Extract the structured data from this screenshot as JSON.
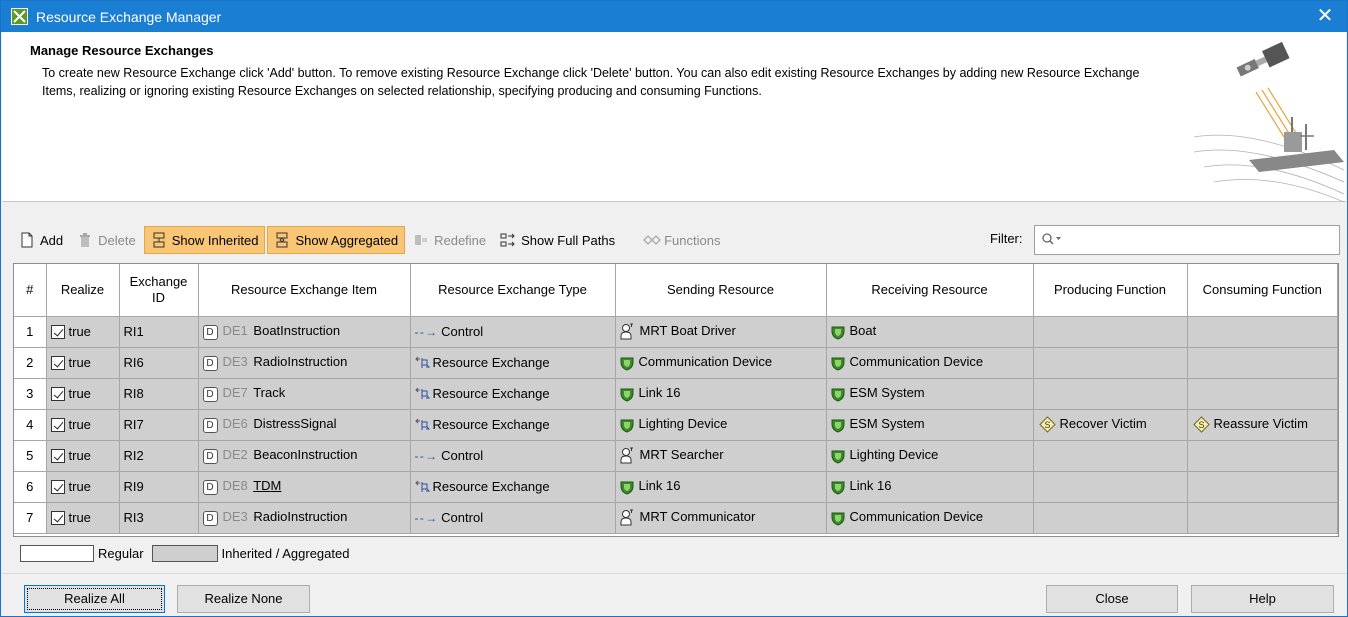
{
  "window": {
    "title": "Resource Exchange Manager",
    "close_glyph": "✕"
  },
  "header": {
    "title": "Manage Resource Exchanges",
    "description": "To create new Resource Exchange click 'Add' button. To remove existing Resource Exchange click 'Delete' button. You can also edit existing Resource Exchanges by adding new Resource Exchange Items, realizing or ignoring existing Resource Exchanges on selected relationship, specifying producing and consuming Functions."
  },
  "toolbar": {
    "add": "Add",
    "delete": "Delete",
    "show_inherited": "Show Inherited",
    "show_aggregated": "Show Aggregated",
    "redefine": "Redefine",
    "show_full_paths": "Show Full Paths",
    "functions": "Functions",
    "filter_label": "Filter:",
    "filter_value": ""
  },
  "table": {
    "columns": [
      "#",
      "Realize",
      "Exchange ID",
      "Resource Exchange Item",
      "Resource Exchange Type",
      "Sending Resource",
      "Receiving Resource",
      "Producing Function",
      "Consuming Function"
    ],
    "rows": [
      {
        "num": "1",
        "realize": "true",
        "id": "RI1",
        "item_id": "DE1",
        "item": "BoatInstruction",
        "item_underline": false,
        "type": "Control",
        "type_kind": "control",
        "sending": "MRT Boat Driver",
        "sending_kind": "person",
        "receiving": "Boat",
        "receiving_kind": "system",
        "producing": "",
        "consuming": ""
      },
      {
        "num": "2",
        "realize": "true",
        "id": "RI6",
        "item_id": "DE3",
        "item": "RadioInstruction",
        "item_underline": false,
        "type": "Resource Exchange",
        "type_kind": "exchange",
        "sending": "Communication Device",
        "sending_kind": "system",
        "receiving": "Communication Device",
        "receiving_kind": "system",
        "producing": "",
        "consuming": ""
      },
      {
        "num": "3",
        "realize": "true",
        "id": "RI8",
        "item_id": "DE7",
        "item": "Track",
        "item_underline": false,
        "type": "Resource Exchange",
        "type_kind": "exchange",
        "sending": "Link 16",
        "sending_kind": "system",
        "receiving": "ESM System",
        "receiving_kind": "system",
        "producing": "",
        "consuming": ""
      },
      {
        "num": "4",
        "realize": "true",
        "id": "RI7",
        "item_id": "DE6",
        "item": "DistressSignal",
        "item_underline": false,
        "type": "Resource Exchange",
        "type_kind": "exchange",
        "sending": "Lighting Device",
        "sending_kind": "system",
        "receiving": "ESM System",
        "receiving_kind": "system",
        "producing": "Recover Victim",
        "consuming": "Reassure Victim"
      },
      {
        "num": "5",
        "realize": "true",
        "id": "RI2",
        "item_id": "DE2",
        "item": "BeaconInstruction",
        "item_underline": false,
        "type": "Control",
        "type_kind": "control",
        "sending": "MRT Searcher",
        "sending_kind": "person",
        "receiving": "Lighting Device",
        "receiving_kind": "system",
        "producing": "",
        "consuming": ""
      },
      {
        "num": "6",
        "realize": "true",
        "id": "RI9",
        "item_id": "DE8",
        "item": "TDM",
        "item_underline": true,
        "type": "Resource Exchange",
        "type_kind": "exchange",
        "sending": "Link 16",
        "sending_kind": "system",
        "receiving": "Link 16",
        "receiving_kind": "system",
        "producing": "",
        "consuming": ""
      },
      {
        "num": "7",
        "realize": "true",
        "id": "RI3",
        "item_id": "DE3",
        "item": "RadioInstruction",
        "item_underline": false,
        "type": "Control",
        "type_kind": "control",
        "sending": "MRT Communicator",
        "sending_kind": "person",
        "receiving": "Communication Device",
        "receiving_kind": "system",
        "producing": "",
        "consuming": ""
      }
    ]
  },
  "legend": {
    "regular": "Regular",
    "inherited": "Inherited / Aggregated"
  },
  "footer": {
    "realize_all": "Realize All",
    "realize_none": "Realize None",
    "close": "Close",
    "help": "Help"
  },
  "colors": {
    "titlebar": "#1a7ed3",
    "toggle_active": "#f8c675",
    "inherited_row": "#cfcfcf",
    "system_icon": "#3a8a2a"
  }
}
